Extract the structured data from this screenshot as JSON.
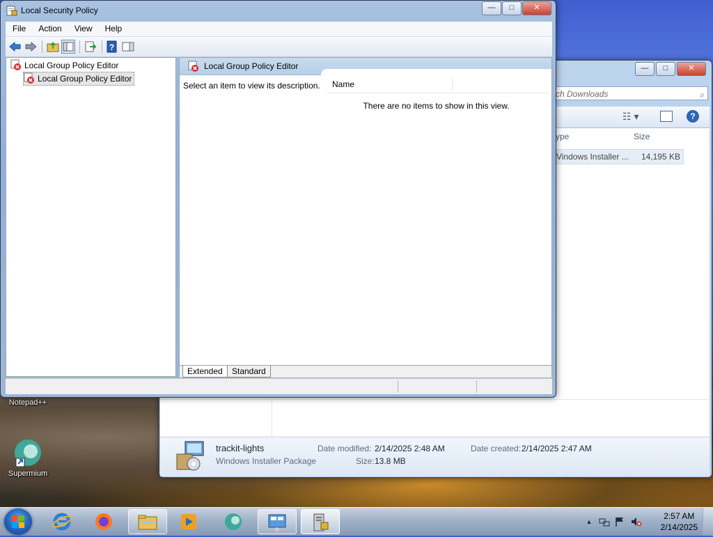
{
  "window": {
    "title": "Local Security Policy",
    "menu": [
      "File",
      "Action",
      "View",
      "Help"
    ],
    "tree": {
      "root_label": "Local Group Policy Editor",
      "child_label": "Local Group Policy Editor"
    },
    "pane_header": "Local Group Policy Editor",
    "description": "Select an item to view its description.",
    "list": {
      "column_name": "Name",
      "empty_message": "There are no items to show in this view."
    },
    "tabs": [
      "Extended",
      "Standard"
    ],
    "caption_buttons": {
      "minimize": "—",
      "maximize": "□",
      "close": "✕"
    }
  },
  "explorer": {
    "search_placeholder": "rch Downloads",
    "columns": {
      "type": "ype",
      "size": "Size"
    },
    "row": {
      "type": "Vindows Installer ...",
      "size": "14,195 KB"
    },
    "details": {
      "file_name": "trackit-lights",
      "file_type": "Windows Installer Package",
      "date_modified_label": "Date modified:",
      "date_modified": "2/14/2025 2:48 AM",
      "date_created_label": "Date created:",
      "date_created": "2/14/2025 2:47 AM",
      "size_label": "Size:",
      "size": "13.8 MB"
    },
    "caption_buttons": {
      "minimize": "—",
      "maximize": "□",
      "close": "✕"
    }
  },
  "desktop": {
    "icons": [
      {
        "label": "Notepad++"
      },
      {
        "label": "Supermium"
      }
    ]
  },
  "taskbar": {
    "apps": [
      "internet-explorer",
      "firefox",
      "file-explorer",
      "media-player",
      "supermium",
      "control-panel",
      "local-security-policy"
    ],
    "clock_time": "2:57 AM",
    "clock_date": "2/14/2025"
  },
  "colors": {
    "accent": "#3a6ea5",
    "pane_header": "#c9dcee",
    "error_icon": "#d62b2b"
  }
}
